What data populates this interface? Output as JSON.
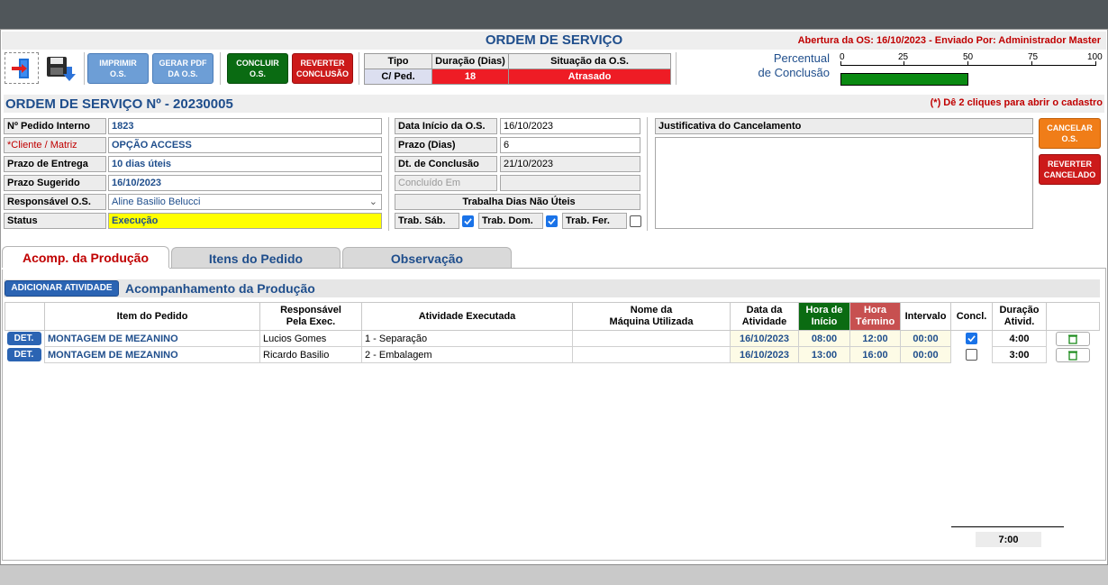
{
  "header": {
    "title": "ORDEM DE SERVIÇO",
    "opened_info": "Abertura da OS: 16/10/2023 - Enviado Por: Administrador Master"
  },
  "toolbar": {
    "print_label": "IMPRIMIR\nO.S.",
    "pdf_label": "GERAR PDF\nDA O.S.",
    "conclude_label": "CONCLUIR\nO.S.",
    "revert_label": "REVERTER\nCONCLUSÃO"
  },
  "summary": {
    "type_header": "Tipo",
    "duration_header": "Duração (Dias)",
    "status_header": "Situação da O.S.",
    "type_value": "C/ Ped.",
    "duration_value": "18",
    "status_value": "Atrasado"
  },
  "progress": {
    "label_line1": "Percentual",
    "label_line2": "de Conclusão",
    "ticks": [
      "0",
      "25",
      "50",
      "75",
      "100"
    ],
    "value_fraction": 0.5
  },
  "os": {
    "number_title": "ORDEM DE SERVIÇO Nº - 20230005",
    "hint": "(*) Dê 2 cliques para abrir o cadastro"
  },
  "fields_left": {
    "pedido_label": "Nº Pedido Interno",
    "pedido_value": "1823",
    "cliente_label": "*Cliente / Matriz",
    "cliente_value": "OPÇÃO ACCESS",
    "prazo_entrega_label": "Prazo de Entrega",
    "prazo_entrega_value": "10 dias úteis",
    "prazo_sugerido_label": "Prazo Sugerido",
    "prazo_sugerido_value": "16/10/2023",
    "responsavel_label": "Responsável O.S.",
    "responsavel_value": "Aline Basilio Belucci",
    "status_label": "Status",
    "status_value": "Execução"
  },
  "fields_mid": {
    "inicio_label": "Data Início da O.S.",
    "inicio_value": "16/10/2023",
    "prazo_dias_label": "Prazo (Dias)",
    "prazo_dias_value": "6",
    "conclusao_label": "Dt. de Conclusão",
    "conclusao_value": "21/10/2023",
    "concluido_label": "Concluído Em",
    "concluido_value": "",
    "nao_uteis_label": "Trabalha Dias Não Úteis",
    "sab_label": "Trab. Sáb.",
    "sab_checked": true,
    "dom_label": "Trab. Dom.",
    "dom_checked": true,
    "fer_label": "Trab. Fer.",
    "fer_checked": false
  },
  "cancel": {
    "justificativa_label": "Justificativa do Cancelamento",
    "justificativa_value": "",
    "cancel_button": "CANCELAR\nO.S.",
    "revert_cancel_button": "REVERTER\nCANCELADO"
  },
  "tabs": [
    {
      "label": "Acomp. da Produção",
      "active": true
    },
    {
      "label": "Itens do Pedido",
      "active": false
    },
    {
      "label": "Observação",
      "active": false
    }
  ],
  "production": {
    "add_button": "ADICIONAR ATIVIDADE",
    "section_title": "Acompanhamento da Produção",
    "columns": {
      "item": "Item do Pedido",
      "responsavel": "Responsável\nPela Exec.",
      "atividade": "Atividade Executada",
      "maquina": "Nome da\nMáquina Utilizada",
      "data": "Data da\nAtividade",
      "inicio": "Hora de\nInício",
      "termino": "Hora\nTérmino",
      "intervalo": "Intervalo",
      "concl": "Concl.",
      "duracao": "Duração\nAtivid."
    },
    "det_label": "DET.",
    "rows": [
      {
        "item": "MONTAGEM DE MEZANINO",
        "responsavel": "Lucios Gomes",
        "atividade": "1 - Separação",
        "maquina": "",
        "data": "16/10/2023",
        "inicio": "08:00",
        "termino": "12:00",
        "intervalo": "00:00",
        "concl": true,
        "duracao": "4:00"
      },
      {
        "item": "MONTAGEM DE MEZANINO",
        "responsavel": "Ricardo Basilio",
        "atividade": "2 - Embalagem",
        "maquina": "",
        "data": "16/10/2023",
        "inicio": "13:00",
        "termino": "16:00",
        "intervalo": "00:00",
        "concl": false,
        "duracao": "3:00"
      }
    ],
    "total_duration": "7:00"
  },
  "colors": {
    "blue_text": "#1f4e8c",
    "red_text": "#c00000",
    "status_yellow": "#ffff00",
    "progress_green": "#0a8a12",
    "late_red": "#ee1c25"
  }
}
